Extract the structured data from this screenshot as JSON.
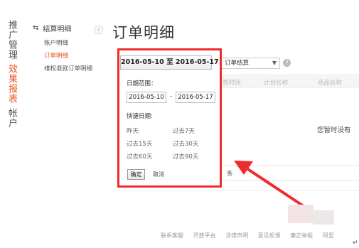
{
  "nav": {
    "groups": [
      {
        "label": "推广管理",
        "active": false
      },
      {
        "label": "效果报表",
        "active": true
      },
      {
        "label": "帐户",
        "active": false
      }
    ]
  },
  "submenu": {
    "header": "结算明细",
    "items": [
      {
        "label": "账户明细",
        "active": false
      },
      {
        "label": "订单明细",
        "active": true
      },
      {
        "label": "维权退款订单明细",
        "active": false
      }
    ],
    "collapse_glyph": "‹"
  },
  "page_title": "订单明细",
  "date_range_button": "2016-05-10 至 2016-05-17",
  "filter_select": {
    "value": "订单结算",
    "arrow": "▼"
  },
  "help_icon": "?",
  "table_headers": {
    "col1": "算时间",
    "col2": "计划名称",
    "col3": "商品名称"
  },
  "empty_message": "您暂时没有",
  "pager_text": "条",
  "datepicker": {
    "range_label": "日期范围：",
    "start_date": "2016-05-10",
    "separator": "-",
    "end_date": "2016-05-17",
    "quick_label": "快捷日期:",
    "quick_options": [
      "昨天",
      "过去7天",
      "过去15天",
      "过去30天",
      "过去60天",
      "过去90天"
    ],
    "confirm": "确定",
    "cancel": "取消"
  },
  "footer_links": [
    "联系客服",
    "开放平台",
    "法律声明",
    "意见反馈",
    "廉正举报",
    "阿里"
  ],
  "return_symbol": "↵",
  "colors": {
    "accent": "#e9531f",
    "highlight_red": "#ef2b2b"
  }
}
